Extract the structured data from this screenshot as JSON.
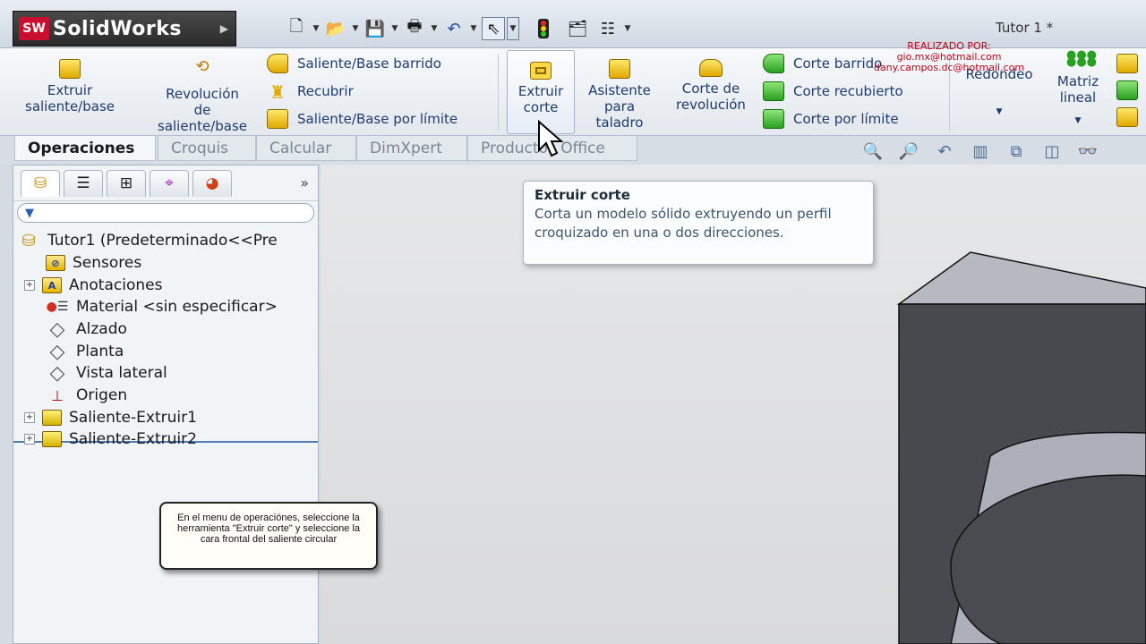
{
  "app": {
    "logo_badge": "SW",
    "name": "SolidWorks",
    "doc_title": "Tutor 1 *"
  },
  "credits": {
    "line1": "REALIZADO POR:",
    "line2": "gio.mx@hotmail.com",
    "line3": "dany.campos.dc@hotmail.com"
  },
  "quick_access": [
    "new-document-icon",
    "open-folder-icon",
    "save-icon",
    "print-icon",
    "undo-icon",
    "select-pointer-icon",
    "rebuild-traffic-light-icon",
    "options-icon",
    "file-properties-icon"
  ],
  "ribbon": {
    "extrude_boss": "Extruir\nsaliente/base",
    "revolve_boss": "Revolución\nde\nsaliente/base",
    "swept_boss": "Saliente/Base barrido",
    "loft": "Recubrir",
    "boundary_boss": "Saliente/Base por límite",
    "extrude_cut": "Extruir\ncorte",
    "hole_wizard": "Asistente\npara\ntaladro",
    "revolve_cut": "Corte de\nrevolución",
    "swept_cut": "Corte barrido",
    "lofted_cut": "Corte recubierto",
    "boundary_cut": "Corte por límite",
    "fillet": "Redondeo",
    "linear_pattern": "Matriz\nlineal"
  },
  "tabs": [
    "Operaciones",
    "Croquis",
    "Calcular",
    "DimXpert",
    "Productos Office"
  ],
  "tooltip": {
    "title": "Extruir corte",
    "body": "Corta un modelo sólido extruyendo un perfil croquizado en una o dos direcciones."
  },
  "tree": {
    "root": "Tutor1  (Predeterminado<<Pre",
    "items": [
      {
        "label": "Sensores",
        "icon": "sensor-icon",
        "expandable": false
      },
      {
        "label": "Anotaciones",
        "icon": "annotations-icon",
        "expandable": true
      },
      {
        "label": "Material <sin especificar>",
        "icon": "material-icon",
        "expandable": false
      },
      {
        "label": "Alzado",
        "icon": "plane-icon",
        "expandable": false
      },
      {
        "label": "Planta",
        "icon": "plane-icon",
        "expandable": false
      },
      {
        "label": "Vista lateral",
        "icon": "plane-icon",
        "expandable": false
      },
      {
        "label": "Origen",
        "icon": "origin-icon",
        "expandable": false
      },
      {
        "label": "Saliente-Extruir1",
        "icon": "extrude-feature-icon",
        "expandable": true
      },
      {
        "label": "Saliente-Extruir2",
        "icon": "extrude-feature-icon",
        "expandable": true
      }
    ]
  },
  "panel_more": "»",
  "note": "En el menu de operaciónes, seleccione la herramienta \"Extruir corte\" y seleccione la cara frontal del saliente circular",
  "colors": {
    "accent": "#1d3b6c",
    "credits": "#c00018",
    "model_face": "#4a4b50",
    "viewport_bg": "#dedfe0"
  }
}
